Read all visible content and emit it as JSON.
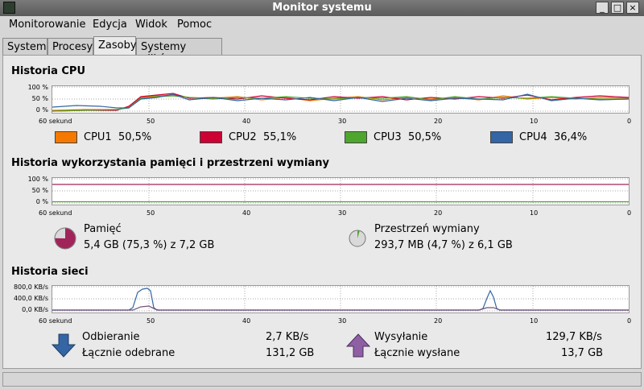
{
  "window": {
    "title": "Monitor systemu"
  },
  "menu": [
    "Monitorowanie",
    "Edycja",
    "Widok",
    "Pomoc"
  ],
  "tabs": [
    "System",
    "Procesy",
    "Zasoby",
    "Systemy plików"
  ],
  "cpu": {
    "title": "Historia CPU",
    "y_ticks": [
      "100 %",
      "50 %",
      "0 %"
    ],
    "x_ticks": [
      "60 sekund",
      "50",
      "40",
      "30",
      "20",
      "10",
      "0"
    ],
    "legend": [
      {
        "label": "CPU1",
        "value": "50,5%",
        "color": "#f57900"
      },
      {
        "label": "CPU2",
        "value": "55,1%",
        "color": "#cc0033"
      },
      {
        "label": "CPU3",
        "value": "50,5%",
        "color": "#4ea62e"
      },
      {
        "label": "CPU4",
        "value": "36,4%",
        "color": "#3465a4"
      }
    ]
  },
  "memory": {
    "title": "Historia wykorzystania pamięci i przestrzeni wymiany",
    "y_ticks": [
      "100 %",
      "50 %",
      "0 %"
    ],
    "x_ticks": [
      "60 sekund",
      "50",
      "40",
      "30",
      "20",
      "10",
      "0"
    ],
    "ram": {
      "label": "Pamięć",
      "detail": "5,4 GB (75,3 %) z 7,2 GB",
      "fraction": 0.753,
      "color": "#a0245a"
    },
    "swap": {
      "label": "Przestrzeń wymiany",
      "detail": "293,7 MB (4,7 %) z 6,1 GB",
      "fraction": 0.047,
      "color": "#4ea62e"
    }
  },
  "network": {
    "title": "Historia sieci",
    "y_ticks": [
      "800,0 KB/s",
      "400,0 KB/s",
      "0,0 KB/s"
    ],
    "x_ticks": [
      "60 sekund",
      "50",
      "40",
      "30",
      "20",
      "10",
      "0"
    ],
    "receive": {
      "label": "Odbieranie",
      "rate": "2,7 KB/s",
      "total_label": "Łącznie odebrane",
      "total": "131,2 GB",
      "color": "#3465a4"
    },
    "send": {
      "label": "Wysyłanie",
      "rate": "129,7 KB/s",
      "total_label": "Łącznie wysłane",
      "total": "13,7 GB",
      "color": "#75507b"
    }
  }
}
